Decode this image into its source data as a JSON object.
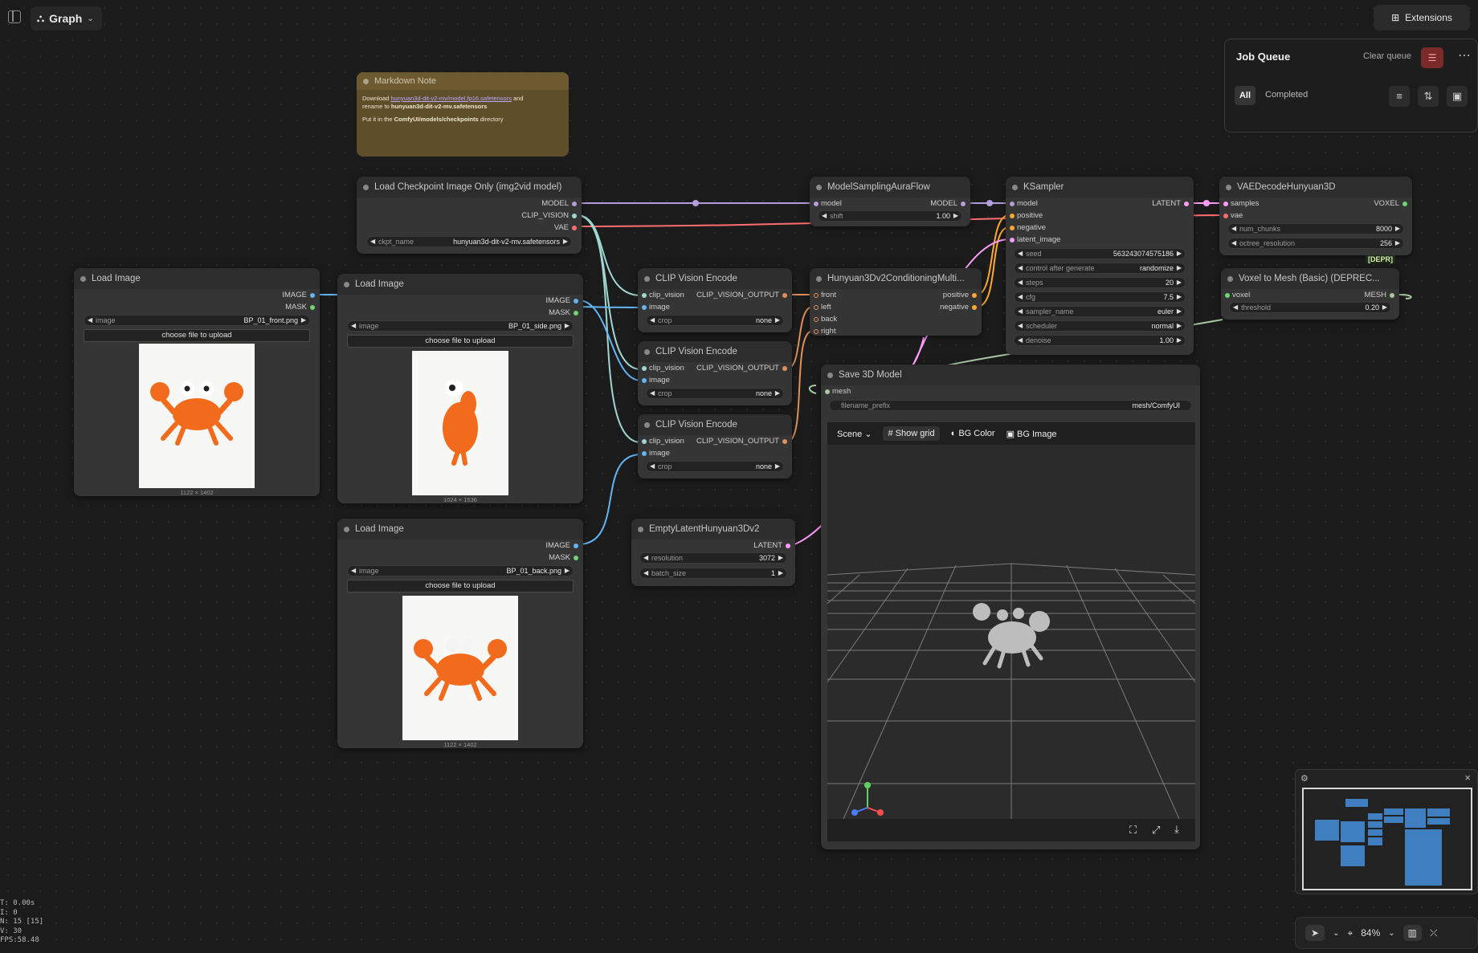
{
  "topbar": {
    "graph_label": "Graph",
    "extensions_label": "Extensions"
  },
  "job_queue": {
    "title": "Job Queue",
    "clear_label": "Clear queue",
    "tab_all": "All",
    "tab_completed": "Completed"
  },
  "markdown_note": {
    "title": "Markdown Note",
    "line1_prefix": "Download ",
    "line1_link": "hunyuan3d-dit-v2-mv/model.fp16.safetensors",
    "line1_suffix": " and",
    "line2_prefix": "rename to ",
    "line2_bold": "hunyuan3d-dit-v2-mv.safetensors",
    "line3_prefix": "Put it in the ",
    "line3_bold": "ComfyUI/models/checkpoints",
    "line3_suffix": " directory"
  },
  "load_checkpoint": {
    "title": "Load Checkpoint Image Only (img2vid model)",
    "out_model": "MODEL",
    "out_clip_vision": "CLIP_VISION",
    "out_vae": "VAE",
    "ckpt_label": "ckpt_name",
    "ckpt_value": "hunyuan3d-dit-v2-mv.safetensors"
  },
  "load_image_front": {
    "title": "Load Image",
    "out_image": "IMAGE",
    "out_mask": "MASK",
    "image_label": "image",
    "image_value": "BP_01_front.png",
    "upload_label": "choose file to upload",
    "dims": "1122 × 1402"
  },
  "load_image_side": {
    "title": "Load Image",
    "out_image": "IMAGE",
    "out_mask": "MASK",
    "image_label": "image",
    "image_value": "BP_01_side.png",
    "upload_label": "choose file to upload",
    "dims": "1024 × 1536"
  },
  "load_image_back": {
    "title": "Load Image",
    "out_image": "IMAGE",
    "out_mask": "MASK",
    "image_label": "image",
    "image_value": "BP_01_back.png",
    "upload_label": "choose file to upload",
    "dims": "1122 × 1402"
  },
  "clip_encode": {
    "title": "CLIP Vision Encode",
    "in_clip": "clip_vision",
    "in_image": "image",
    "out": "CLIP_VISION_OUTPUT",
    "crop_label": "crop",
    "crop_value": "none"
  },
  "model_sampling": {
    "title": "ModelSamplingAuraFlow",
    "in_model": "model",
    "out_model": "MODEL",
    "shift_label": "shift",
    "shift_value": "1.00"
  },
  "conditioning": {
    "title": "Hunyuan3Dv2ConditioningMulti...",
    "in_front": "front",
    "in_left": "left",
    "in_back": "back",
    "in_right": "right",
    "out_positive": "positive",
    "out_negative": "negative"
  },
  "ksampler": {
    "title": "KSampler",
    "in_model": "model",
    "in_positive": "positive",
    "in_negative": "negative",
    "in_latent": "latent_image",
    "out_latent": "LATENT",
    "widgets": [
      {
        "label": "seed",
        "value": "563243074575186"
      },
      {
        "label": "control after generate",
        "value": "randomize"
      },
      {
        "label": "steps",
        "value": "20"
      },
      {
        "label": "cfg",
        "value": "7.5"
      },
      {
        "label": "sampler_name",
        "value": "euler"
      },
      {
        "label": "scheduler",
        "value": "normal"
      },
      {
        "label": "denoise",
        "value": "1.00"
      }
    ]
  },
  "vae_decode": {
    "title": "VAEDecodeHunyuan3D",
    "in_samples": "samples",
    "in_vae": "vae",
    "out_voxel": "VOXEL",
    "num_chunks_label": "num_chunks",
    "num_chunks_value": "8000",
    "octree_label": "octree_resolution",
    "octree_value": "256",
    "badge": "[DEPR]"
  },
  "voxel_to_mesh": {
    "title": "Voxel to Mesh (Basic) (DEPREC...",
    "in_voxel": "voxel",
    "out_mesh": "MESH",
    "threshold_label": "threshold",
    "threshold_value": "0.20"
  },
  "empty_latent": {
    "title": "EmptyLatentHunyuan3Dv2",
    "out_latent": "LATENT",
    "resolution_label": "resolution",
    "resolution_value": "3072",
    "batch_label": "batch_size",
    "batch_value": "1"
  },
  "save_3d": {
    "title": "Save 3D Model",
    "in_mesh": "mesh",
    "prefix_label": "filename_prefix",
    "prefix_value": "mesh/ComfyUI",
    "scene_label": "Scene",
    "show_grid_label": "Show grid",
    "bg_color_label": "BG Color",
    "bg_image_label": "BG Image"
  },
  "bottom_bar": {
    "zoom": "84%"
  },
  "stats": [
    "T: 0.00s",
    "I: 0",
    "N: 15 [15]",
    "V: 30",
    "FPS:58.48"
  ],
  "colors": {
    "model_wire": "#b39ddb",
    "clip_vision_wire": "#a0d8d0",
    "vae_wire": "#ff6e6e",
    "image_wire": "#64b5f6",
    "clip_out_wire": "#e0915a",
    "latent_wire": "#ff9cf9",
    "conditioning_wire": "#ffa931",
    "mesh_wire": "#a8c8a0"
  }
}
